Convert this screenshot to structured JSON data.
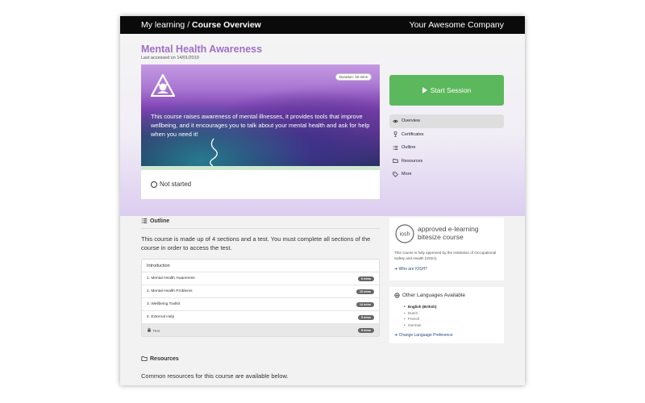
{
  "header": {
    "breadcrumb_parent": "My learning / ",
    "breadcrumb_current": "Course Overview",
    "company": "Your Awesome Company"
  },
  "course": {
    "title": "Mental Health Awareness",
    "last_accessed": "Last accessed on 14/01/2019",
    "duration": "Duration: 40 mins",
    "description": "This course raises awareness of mental illnesses, it provides tools that improve wellbeing, and it encourages you to talk about your mental health and ask for help when you need it!",
    "status": "Not started",
    "progress": 0
  },
  "actions": {
    "start_label": "Start Session"
  },
  "side_nav": {
    "items": [
      {
        "label": "Overview",
        "icon": "eye-icon",
        "active": true
      },
      {
        "label": "Certificates",
        "icon": "trophy-icon"
      },
      {
        "label": "Outline",
        "icon": "list-icon"
      },
      {
        "label": "Resources",
        "icon": "folder-icon"
      },
      {
        "label": "More",
        "icon": "tags-icon"
      }
    ]
  },
  "outline": {
    "heading": "Outline",
    "description": "This course is made up of 4 sections and a test. You must complete all sections of the course in order to access the test.",
    "intro_label": "Introduction",
    "sections": [
      {
        "label": "1. Mental Health Awareness",
        "duration": "6 mins"
      },
      {
        "label": "2. Mental Health Problems",
        "duration": "10 mins"
      },
      {
        "label": "3. Wellbeing Toolkit",
        "duration": "14 mins"
      },
      {
        "label": "4. External Help",
        "duration": "5 mins"
      },
      {
        "label": "Test",
        "duration": "5 mins",
        "locked": true
      }
    ]
  },
  "resources": {
    "heading": "Resources",
    "description": "Common resources for this course are available below."
  },
  "iosh": {
    "logo_text": "iosh",
    "title_line1": "approved e-learning",
    "title_line2": "bitesize course",
    "description": "This course is fully approved by the Institution of Occupational Safety and Health (IOSH).",
    "link": "Who are IOSH?"
  },
  "languages": {
    "heading": "Other Languages Available",
    "items": [
      {
        "label": "English (British)",
        "selected": true
      },
      {
        "label": "Dutch"
      },
      {
        "label": "French"
      },
      {
        "label": "German"
      }
    ],
    "link": "Change Language Preference"
  },
  "colors": {
    "accent": "#a070c8",
    "start_button": "#5cb85c",
    "topbar": "#0a0a0a",
    "link": "#2a4c7a"
  }
}
